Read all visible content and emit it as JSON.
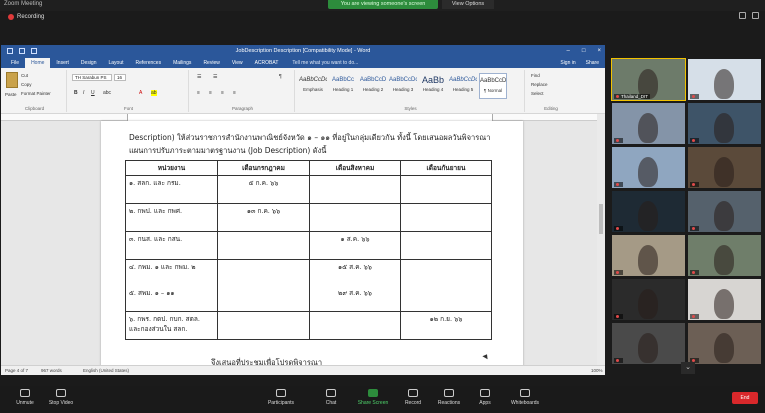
{
  "zoom": {
    "window_title": "Zoom Meeting",
    "share_banner": "You are viewing someone's screen",
    "view_options": "View Options",
    "recording": "Recording",
    "toolbar": [
      {
        "key": "unmute",
        "label": "Unmute"
      },
      {
        "key": "video",
        "label": "Stop Video"
      },
      {
        "key": "participants",
        "label": "Participants"
      },
      {
        "key": "chat",
        "label": "Chat"
      },
      {
        "key": "share",
        "label": "Share Screen"
      },
      {
        "key": "record",
        "label": "Record"
      },
      {
        "key": "reactions",
        "label": "Reactions"
      },
      {
        "key": "apps",
        "label": "Apps"
      },
      {
        "key": "whiteboards",
        "label": "Whiteboards"
      }
    ],
    "end_label": "End",
    "participants": [
      {
        "name": "Thailand_DIT",
        "bg": "#6d7b6a"
      },
      {
        "name": "",
        "bg": "#d6dfe8"
      },
      {
        "name": "",
        "bg": "#8494a8"
      },
      {
        "name": "",
        "bg": "#3e5468"
      },
      {
        "name": "",
        "bg": "#8fa6c0"
      },
      {
        "name": "",
        "bg": "#5b4a3a"
      },
      {
        "name": "",
        "bg": "#1e2a34"
      },
      {
        "name": "",
        "bg": "#55616c"
      },
      {
        "name": "",
        "bg": "#a59a86"
      },
      {
        "name": "",
        "bg": "#6f7e6a"
      },
      {
        "name": "",
        "bg": "#2b2b2b"
      },
      {
        "name": "",
        "bg": "#d7d5d2"
      },
      {
        "name": "",
        "bg": "#4a4a4a"
      },
      {
        "name": "",
        "bg": "#6c5f55"
      }
    ]
  },
  "word": {
    "title": "JobDescription Description [Compatibility Mode] - Word",
    "tabs": [
      "File",
      "Home",
      "Insert",
      "Design",
      "Layout",
      "References",
      "Mailings",
      "Review",
      "View",
      "ACROBAT"
    ],
    "tell_me": "Tell me what you want to do...",
    "sign_in": "Sign in",
    "share": "Share",
    "clipboard": {
      "paste": "Paste",
      "cut": "Cut",
      "copy": "Copy",
      "format_painter": "Format Painter",
      "label": "Clipboard"
    },
    "font": {
      "name": "TH Sarabun PS",
      "size": "16",
      "label": "Font"
    },
    "paragraph_label": "Paragraph",
    "styles": [
      {
        "sample": "AaBbCcDc",
        "name": "Emphasis"
      },
      {
        "sample": "AaBbCc",
        "name": "Heading 1"
      },
      {
        "sample": "AaBbCcD",
        "name": "Heading 2"
      },
      {
        "sample": "AaBbCcDc",
        "name": "Heading 3"
      },
      {
        "sample": "AaBb",
        "name": "Heading 4"
      },
      {
        "sample": "AaBbCcDc",
        "name": "Heading 5"
      },
      {
        "sample": "AaBbCcDc",
        "name": "¶ Normal"
      }
    ],
    "styles_label": "Styles",
    "editing": {
      "find": "Find",
      "replace": "Replace",
      "select": "Select",
      "label": "Editing"
    },
    "status": {
      "page": "Page 4 of 7",
      "words": "967 words",
      "language": "English (United States)",
      "zoom": "100%"
    }
  },
  "document": {
    "line1": "Description) ให้ส่วนราชการสำนักงานพาณิชย์จังหวัด ๑ – ๑๑ ที่อยู่ในกลุ่มเดียวกัน ทั้งนี้ โดยเสนอผลวันพิจารณา",
    "line2": "แผนการปรับภาระตามมาตรฐานงาน (Job Description) ดังนี้",
    "headers": [
      "หน่วยงาน",
      "เดือนกรกฎาคม",
      "เดือนสิงหาคม",
      "เดือนกันยายน"
    ],
    "rows": [
      {
        "unit": "๑. สลก. และ กรม.",
        "jul": "๕ ก.ค. ๖๖",
        "aug": "",
        "sep": ""
      },
      {
        "unit": "๒. กพป. และ กพศ.",
        "jul": "๑๓ ก.ค. ๖๖",
        "aug": "",
        "sep": ""
      },
      {
        "unit": "๓. กนส. และ กสน.",
        "jul": "",
        "aug": "๑ ส.ค. ๖๖",
        "sep": ""
      },
      {
        "unit": "๔. กพม. ๑ และ กพม. ๒",
        "unit2": "๕. สพม. ๑ – ๑๑",
        "jul": "",
        "aug": "๑๕ ส.ค. ๖๖",
        "aug2": "๒๙ ส.ค. ๖๖",
        "sep": ""
      },
      {
        "unit": "๖. กพร. กตป. กบก. สตล.",
        "unit2": "และกองส่วนใน สลก.",
        "jul": "",
        "aug": "",
        "sep": "๑๒ ก.ย. ๖๖"
      }
    ],
    "closing": "จึงเสนอที่ประชุมเพื่อโปรดพิจารณา"
  }
}
